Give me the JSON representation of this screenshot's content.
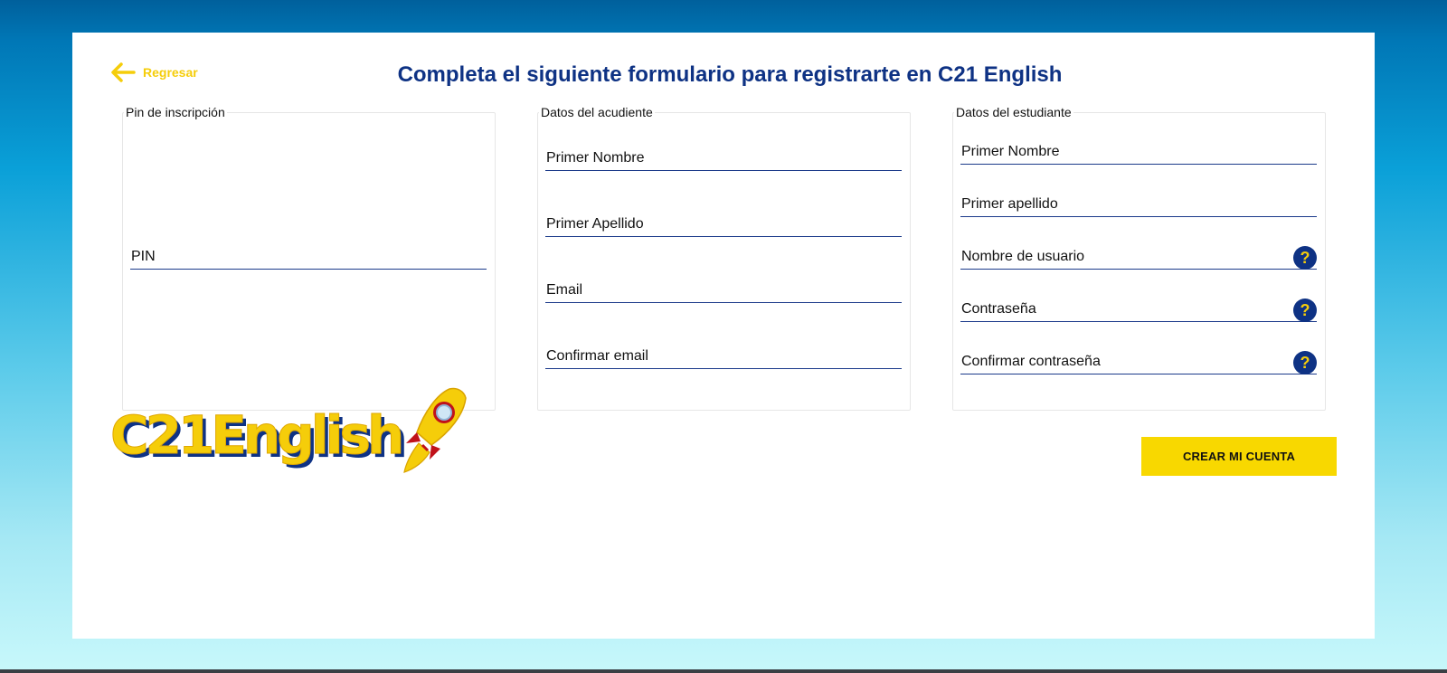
{
  "header": {
    "back_label": "Regresar",
    "title": "Completa el siguiente formulario para registrarte en C21 English"
  },
  "pin_section": {
    "legend": "Pin de inscripción",
    "pin_placeholder": "PIN"
  },
  "guardian_section": {
    "legend": "Datos del acudiente",
    "first_name_placeholder": "Primer Nombre",
    "last_name_placeholder": "Primer Apellido",
    "email_placeholder": "Email",
    "confirm_email_placeholder": "Confirmar email"
  },
  "student_section": {
    "legend": "Datos del estudiante",
    "first_name_placeholder": "Primer Nombre",
    "last_name_placeholder": "Primer apellido",
    "username_placeholder": "Nombre de usuario",
    "password_placeholder": "Contraseña",
    "confirm_password_placeholder": "Confirmar contraseña",
    "help_symbol": "?"
  },
  "logo": {
    "text": "C21English"
  },
  "actions": {
    "create_label": "CREAR MI CUENTA"
  },
  "colors": {
    "brand_yellow": "#f8d800",
    "brand_blue": "#0e3284"
  }
}
